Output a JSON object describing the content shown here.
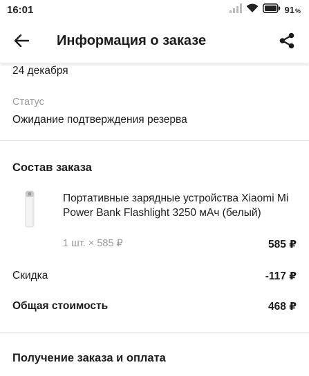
{
  "status_bar": {
    "time": "16:01",
    "battery_value": "91",
    "battery_unit": "%",
    "icons": [
      "signal-icon",
      "wifi-icon",
      "battery-icon"
    ]
  },
  "app_bar": {
    "title": "Информация о заказе",
    "back_icon": "arrow-left-icon",
    "share_icon": "share-icon"
  },
  "order": {
    "date": "24 декабря",
    "status_label": "Статус",
    "status_value": "Ожидание подтверждения резерва"
  },
  "composition": {
    "title": "Состав заказа",
    "item": {
      "name": "Портативные зарядные устройства Xiaomi Mi Power Bank Flashlight 3250 мАч (белый)",
      "quantity_text": "1 шт. × 585 ₽",
      "total": "585 ₽"
    },
    "discount_label": "Скидка",
    "discount_value": "-117 ₽",
    "total_label": "Общая стоимость",
    "total_value": "468 ₽"
  },
  "delivery": {
    "title": "Получение заказа и оплата"
  },
  "colors": {
    "text": "#1c1c1c",
    "secondary_text": "#9b9b9b",
    "divider": "#e6e6e6",
    "background": "#ffffff"
  }
}
